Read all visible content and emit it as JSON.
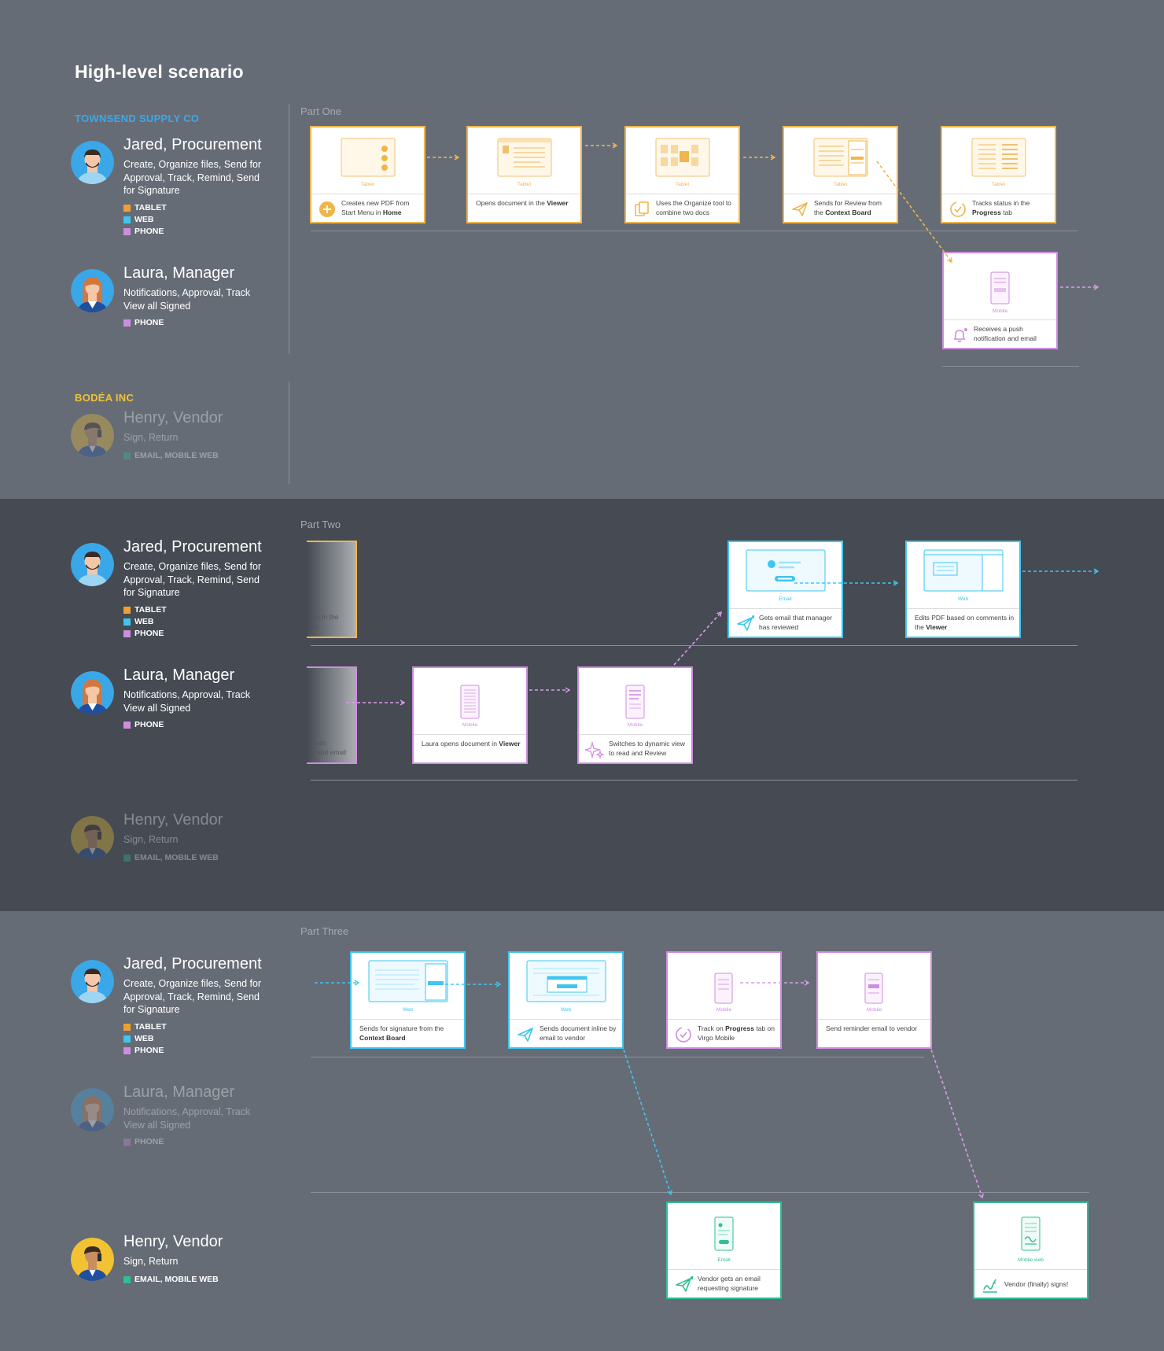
{
  "title": "High-level scenario",
  "companies": {
    "townsend": "TOWNSEND SUPPLY CO",
    "bodea": "BODÉA INC"
  },
  "parts": {
    "one": "Part One",
    "two": "Part Two",
    "three": "Part Three"
  },
  "colors": {
    "tablet": "#f0a030",
    "web": "#3ec6f0",
    "phone": "#cd8ee0",
    "email_mobile_web": "#2fbf93",
    "townsend": "#3aa8e8",
    "bodea": "#f2c233"
  },
  "personas": {
    "jared": {
      "name": "Jared, Procurement",
      "desc": "Create, Organize files, Send for Approval, Track, Remind, Send for Signature",
      "devices": [
        "TABLET",
        "WEB",
        "PHONE"
      ]
    },
    "laura": {
      "name": "Laura, Manager",
      "desc": "Notifications, Approval, Track View all Signed",
      "devices": [
        "PHONE"
      ]
    },
    "henry": {
      "name": "Henry, Vendor",
      "desc": "Sign, Return",
      "devices": [
        "EMAIL, MOBILE WEB"
      ]
    }
  },
  "cards": {
    "p1c1": {
      "type": "Tablet",
      "text": "Creates new PDF from Start Menu in ",
      "bold": "Home",
      "icon": "plus-circle-icon"
    },
    "p1c2": {
      "type": "Tablet",
      "text": "Opens document in the ",
      "bold": "Viewer",
      "icon": ""
    },
    "p1c3": {
      "type": "Tablet",
      "text": "Uses the Organize tool to combine two docs",
      "bold": "",
      "icon": "pages-icon"
    },
    "p1c4": {
      "type": "Tablet",
      "text": "Sends for Review from the ",
      "bold": "Context Board",
      "icon": "send-icon"
    },
    "p1c5": {
      "type": "Tablet",
      "text": "Tracks status in the ",
      "bold": "Progress",
      "tail": " tab",
      "icon": "check-circle-icon"
    },
    "p1c6": {
      "type": "Mobile",
      "text": "Receives a push notification and email",
      "bold": "",
      "icon": "bell-icon"
    },
    "p2f1": {
      "text_a": "tus in the",
      "text_b": "ab"
    },
    "p2f2": {
      "text_a": "push",
      "text_b": "n and email"
    },
    "p2c1": {
      "type": "Mobile",
      "text": "Laura opens document in ",
      "bold": "Viewer",
      "icon": ""
    },
    "p2c2": {
      "type": "Mobile",
      "text": "Switches to dynamic view to read and Review",
      "bold": "",
      "icon": "sparkle-icon"
    },
    "p2c3": {
      "type": "Email",
      "text": "Gets email that manager has reviewed",
      "bold": "",
      "icon": "send-icon"
    },
    "p2c4": {
      "type": "Web",
      "text": "Edits PDF based on comments in the ",
      "bold": "Viewer",
      "icon": ""
    },
    "p3c1": {
      "type": "Web",
      "text": "Sends for signature from the ",
      "bold": "Context Board",
      "icon": ""
    },
    "p3c2": {
      "type": "Web",
      "text": "Sends document inline by email to vendor",
      "bold": "",
      "icon": "send-icon"
    },
    "p3c3": {
      "type": "Mobile",
      "text": "Track on ",
      "bold": "Progress",
      "tail": " tab on Virgo Mobile",
      "icon": "check-circle-icon"
    },
    "p3c4": {
      "type": "Mobile",
      "text": "Send reminder email to vendor",
      "bold": "",
      "icon": ""
    },
    "p3c5": {
      "type": "Email",
      "text": "Vendor gets an email requesting signature",
      "bold": "",
      "icon": "send-icon"
    },
    "p3c6": {
      "type": "Mobile web",
      "text": "Vendor (finally) signs!",
      "bold": "",
      "icon": "sign-icon"
    }
  }
}
